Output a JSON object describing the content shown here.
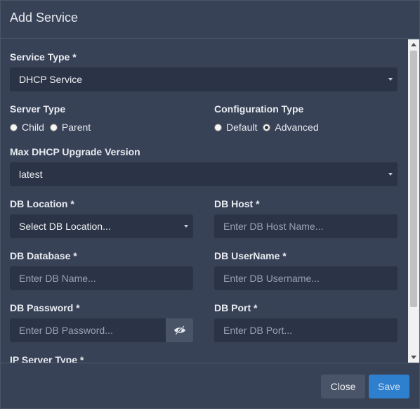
{
  "modal": {
    "title": "Add Service"
  },
  "service_type": {
    "label": "Service Type *",
    "value": "DHCP Service"
  },
  "server_type": {
    "label": "Server Type",
    "options": [
      "Child",
      "Parent"
    ],
    "selected": "Parent"
  },
  "configuration_type": {
    "label": "Configuration Type",
    "options": [
      "Default",
      "Advanced"
    ],
    "selected": "Advanced"
  },
  "max_dhcp_upgrade": {
    "label": "Max DHCP Upgrade Version",
    "value": "latest"
  },
  "db_location": {
    "label": "DB Location *",
    "value": "Select DB Location..."
  },
  "db_host": {
    "label": "DB Host *",
    "placeholder": "Enter DB Host Name..."
  },
  "db_database": {
    "label": "DB Database *",
    "placeholder": "Enter DB Name..."
  },
  "db_username": {
    "label": "DB UserName *",
    "placeholder": "Enter DB Username..."
  },
  "db_password": {
    "label": "DB Password *",
    "placeholder": "Enter DB Password...",
    "toggle_icon": "eye-slash-icon"
  },
  "db_port": {
    "label": "DB Port *",
    "placeholder": "Enter DB Port..."
  },
  "ip_server_type": {
    "label": "IP Server Type *"
  },
  "footer": {
    "close_label": "Close",
    "save_label": "Save"
  },
  "colors": {
    "primary": "#2f7fcf",
    "modal_bg": "#384257",
    "input_bg": "#2b3346"
  }
}
